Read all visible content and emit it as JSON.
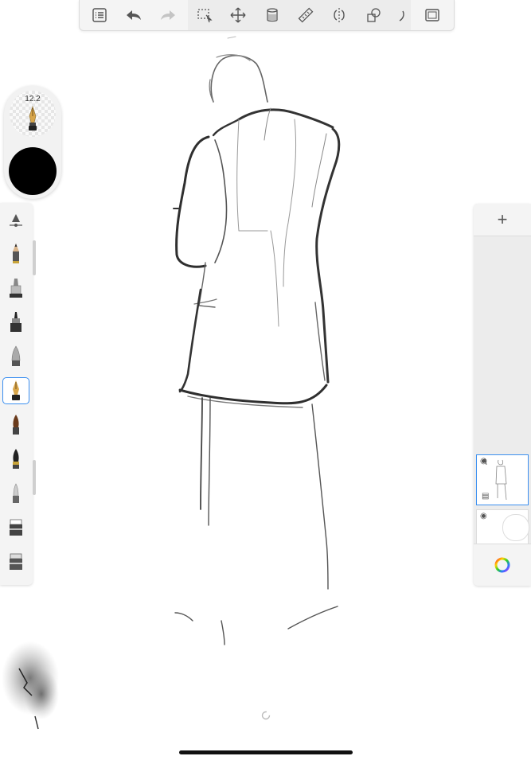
{
  "brush": {
    "size_label": "12.2",
    "current_color": "#000000"
  },
  "toolbar": {
    "left_tools": [
      "list-icon",
      "undo-icon",
      "redo-icon"
    ],
    "main_tools": [
      "selection-icon",
      "transform-icon",
      "fill-icon",
      "ruler-icon",
      "symmetry-icon",
      "shapes-icon"
    ],
    "right_tools": [
      "fullscreen-icon"
    ]
  },
  "brush_palette": {
    "items": [
      "brush-properties",
      "pencil",
      "marker",
      "felt-pen",
      "airbrush",
      "ink-pen",
      "paint-brush",
      "chisel-brush",
      "soft-brush",
      "eraser",
      "hard-eraser"
    ],
    "selected_index": 4
  },
  "layers": {
    "add_label": "+",
    "items": [
      {
        "name": "sketch-layer",
        "selected": true
      },
      {
        "name": "background-layer",
        "selected": false
      }
    ]
  },
  "colors": {
    "accent": "#3b8ff0",
    "panel": "#f4f4f4"
  }
}
